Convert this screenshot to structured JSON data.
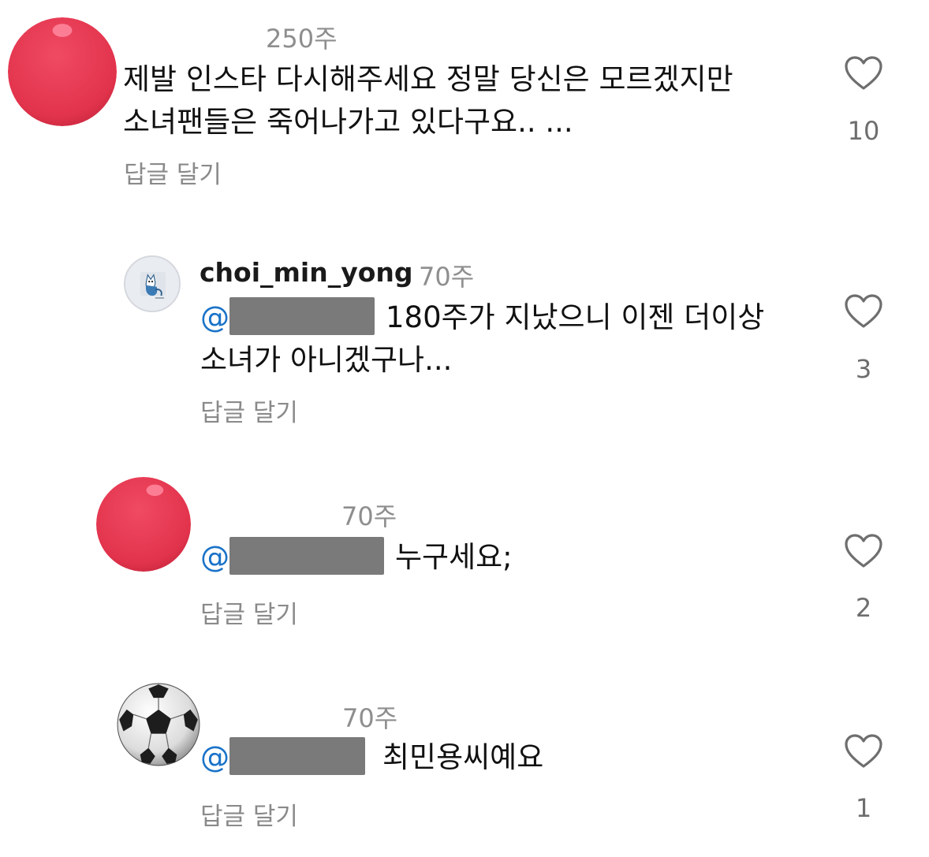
{
  "comments": [
    {
      "username": "",
      "time": "250주",
      "text_line1": "제발 인스타 다시해주세요 정말 당신은 모르겠지만",
      "text_line2": "소녀팬들은 죽어나가고 있다구요.. ...",
      "reply_label": "답글 달기",
      "likes": "10",
      "avatar": "red-circle-avatar",
      "avatar_color": "#e8384f"
    },
    {
      "username": "choi_min_yong",
      "time": "70주",
      "mention": "@",
      "text_line1": "180주가 지났으니 이젠 더이상",
      "text_line2": "소녀가 아니겠구나...",
      "reply_label": "답글 달기",
      "likes": "3",
      "avatar": "cartoon-fox-avatar"
    },
    {
      "username": "",
      "time": "70주",
      "mention": "@",
      "text": "누구세요;",
      "reply_label": "답글 달기",
      "likes": "2",
      "avatar": "red-circle-avatar",
      "avatar_color": "#e8384f"
    },
    {
      "username": "",
      "time": "70주",
      "mention": "@",
      "text": "최민용씨예요",
      "reply_label": "답글 달기",
      "likes": "1",
      "avatar": "soccer-ball-avatar"
    }
  ],
  "icons": {
    "like": "heart-outline-icon"
  },
  "colors": {
    "mention": "#1a73c8",
    "timestamp": "#8e8e8e",
    "redaction": "#7a7a7a"
  }
}
